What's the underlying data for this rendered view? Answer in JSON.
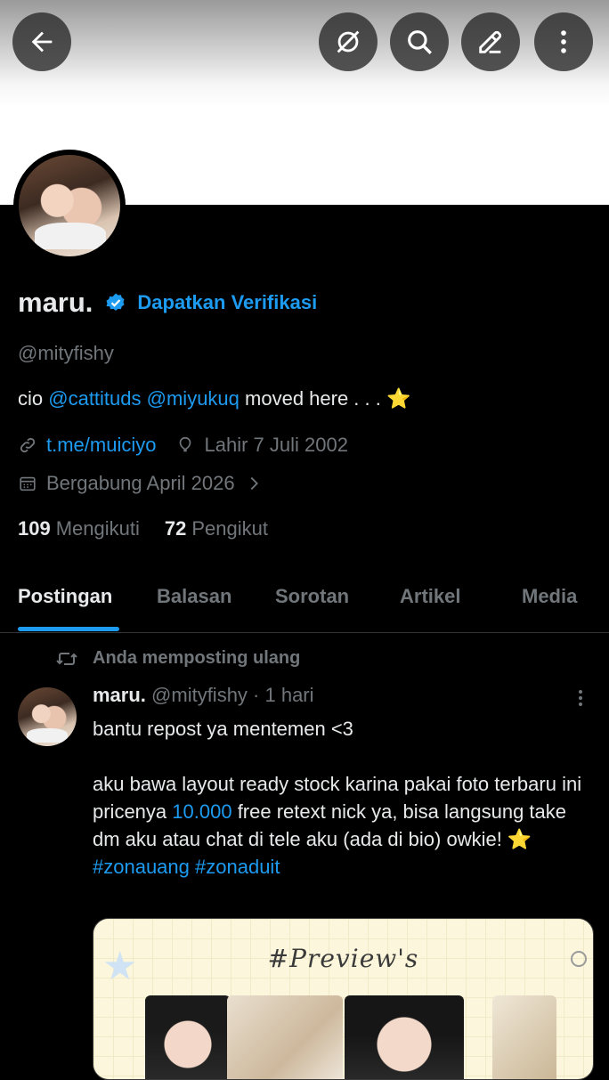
{
  "header": {
    "back_icon": "arrow-left-icon",
    "buttons": [
      "grok-icon",
      "search-icon",
      "edit-icon",
      "more-vertical-icon"
    ]
  },
  "profile": {
    "display_name": "maru.",
    "verified_icon": "verified-badge-icon",
    "get_verified_label": "Dapatkan Verifikasi",
    "handle": "@mityfishy",
    "bio": {
      "prefix": "cio ",
      "mention1": "@cattituds",
      "space": " ",
      "mention2": "@miyukuq",
      "suffix": " moved here . . . ⭐"
    },
    "link": "t.me/muiciyo",
    "birthday": "Lahir 7 Juli 2002",
    "joined": "Bergabung April 2026",
    "following_count": "109",
    "following_label": "Mengikuti",
    "followers_count": "72",
    "followers_label": "Pengikut"
  },
  "tabs": [
    "Postingan",
    "Balasan",
    "Sorotan",
    "Artikel",
    "Media"
  ],
  "colors": {
    "accent": "#1d9bf0",
    "muted": "#71767b",
    "text": "#e7e9ea",
    "background": "#000000"
  },
  "post": {
    "repost_label": "Anda memposting ulang",
    "author_name": "maru.",
    "author_meta": " @mityfishy · 1 hari",
    "line1": "bantu repost ya mentemen <3",
    "body_prefix": "aku bawa layout ready stock karina pakai foto terbaru ini pricenya ",
    "price": "10.000",
    "body_suffix": " free retext nick ya, bisa langsung take dm aku atau chat di tele aku (ada di bio) owkie! ⭐",
    "hashtag1": "#zonauang",
    "hashtag2": "#zonaduit",
    "media_title": "#Preview's"
  }
}
